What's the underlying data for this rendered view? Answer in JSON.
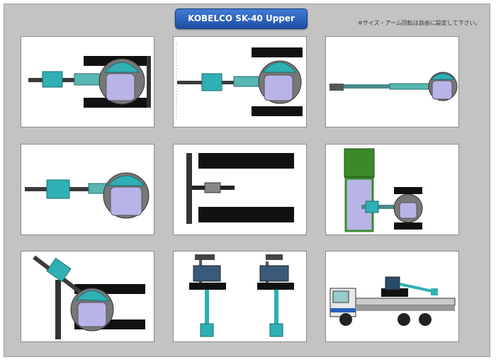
{
  "header": {
    "title": "KOBELCO SK-40 Upper",
    "note": "※サイズ・アーム回転は自由に設定して下さい。"
  },
  "thumbnails": [
    {
      "name": "thumb-top-view-arm-left"
    },
    {
      "name": "thumb-top-view-arm-left-wide"
    },
    {
      "name": "thumb-top-view-arm-extended"
    },
    {
      "name": "thumb-top-view-no-tracks"
    },
    {
      "name": "thumb-tracks-only"
    },
    {
      "name": "thumb-with-dump-truck"
    },
    {
      "name": "thumb-rotated-arm"
    },
    {
      "name": "thumb-front-rear-views"
    },
    {
      "name": "thumb-on-truck-side-view"
    }
  ],
  "colors": {
    "teal": "#2fb0b4",
    "cab": "#b8b4e8",
    "track": "#1a1a1a",
    "truck_green": "#3a8a2a",
    "title_blue": "#2a5fbd"
  }
}
